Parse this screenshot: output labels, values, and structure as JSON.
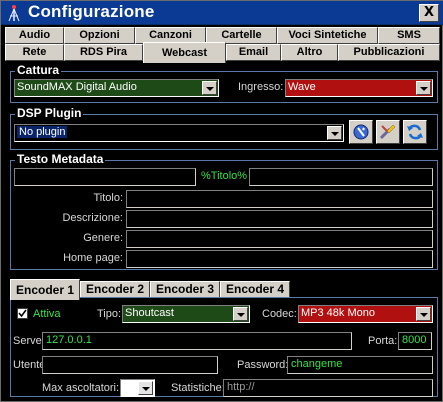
{
  "window": {
    "title": "Configurazione",
    "close_label": "X"
  },
  "tabs_row1": [
    "Audio",
    "Opzioni",
    "Canzoni",
    "Cartelle",
    "Voci Sintetiche",
    "SMS"
  ],
  "tabs_row2": [
    "Rete",
    "RDS Pira",
    "Webcast",
    "Email",
    "Altro",
    "Pubblicazioni"
  ],
  "active_tab": "Webcast",
  "cattura": {
    "label": "Cattura",
    "device": "SoundMAX Digital Audio",
    "ingresso_label": "Ingresso:",
    "ingresso_value": "Wave"
  },
  "dsp": {
    "label": "DSP Plugin",
    "value": "No plugin"
  },
  "metadata": {
    "label": "Testo Metadata",
    "titolo_token": "%Titolo%",
    "fields": {
      "titolo": "Titolo:",
      "descrizione": "Descrizione:",
      "genere": "Genere:",
      "homepage": "Home page:"
    }
  },
  "encoder_tabs": [
    "Encoder 1",
    "Encoder 2",
    "Encoder 3",
    "Encoder 4"
  ],
  "active_encoder": "Encoder 1",
  "encoder": {
    "attiva_label": "Attiva",
    "tipo_label": "Tipo:",
    "tipo_value": "Shoutcast",
    "codec_label": "Codec:",
    "codec_value": "MP3 48k Mono",
    "server_label": "Server:",
    "server_value": "127.0.0.1",
    "porta_label": "Porta:",
    "porta_value": "8000",
    "utente_label": "Utente:",
    "utente_value": "",
    "password_label": "Password:",
    "password_value": "changeme",
    "max_label": "Max ascoltatori:",
    "max_value": "",
    "statistiche_label": "Statistiche:",
    "statistiche_value": "http://"
  },
  "colors": {
    "titlebar": "#0a3a94",
    "field_text_green": "#39e04a",
    "combo_red": "#b01010",
    "combo_green": "#1e4a18",
    "group_border": "#5a78a8"
  }
}
